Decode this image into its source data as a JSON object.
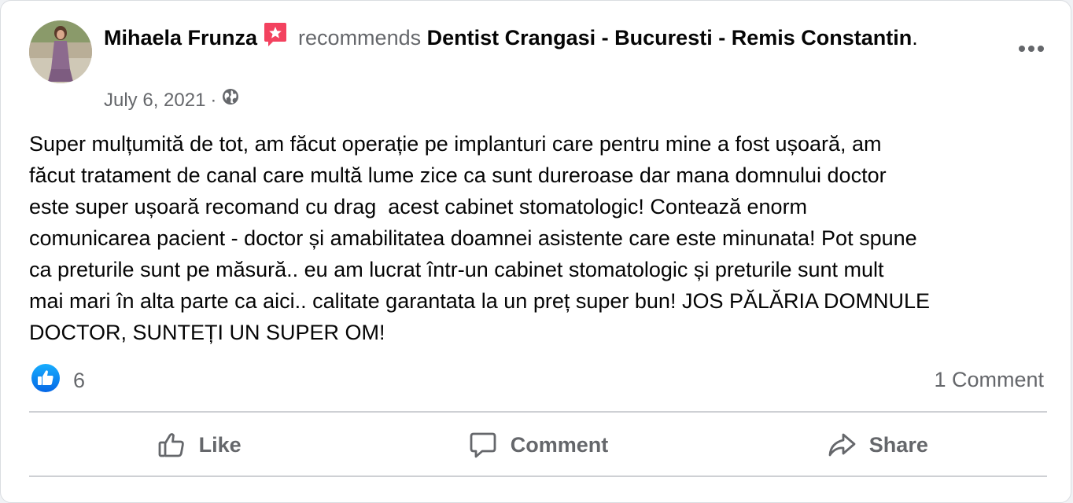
{
  "post": {
    "author": "Mihaela Frunza",
    "verb": "recommends",
    "page_name": "Dentist Crangasi - Bucuresti - Remis Constantin",
    "period": ".",
    "date": "July 6, 2021",
    "separator": "·",
    "privacy_icon": "globe-icon",
    "recommend_badge_icon": "recommend-star-icon",
    "body": "Super mulțumită de tot, am făcut operație pe implanturi care pentru mine a fost ușoară, am\nfăcut tratament de canal care multă lume zice ca sunt dureroase dar mana domnului doctor\neste super ușoară recomand cu drag  acest cabinet stomatologic! Contează enorm\ncomunicarea pacient - doctor și amabilitatea doamnei asistente care este minunata! Pot spune\nca preturile sunt pe măsură.. eu am lucrat într-un cabinet stomatologic și preturile sunt mult\nmai mari în alta parte ca aici.. calitate garantata la un preț super bun! JOS PĂLĂRIA DOMNULE\nDOCTOR, SUNTEȚI UN SUPER OM!",
    "reactions": {
      "icon": "like-reaction-icon",
      "count": "6"
    },
    "comments_count": "1 Comment"
  },
  "actions": {
    "like_label": "Like",
    "comment_label": "Comment",
    "share_label": "Share"
  },
  "colors": {
    "accent_blue": "#1877f2",
    "recommend_pink": "#f3425f",
    "muted_text": "#65676b",
    "primary_text": "#050505"
  }
}
